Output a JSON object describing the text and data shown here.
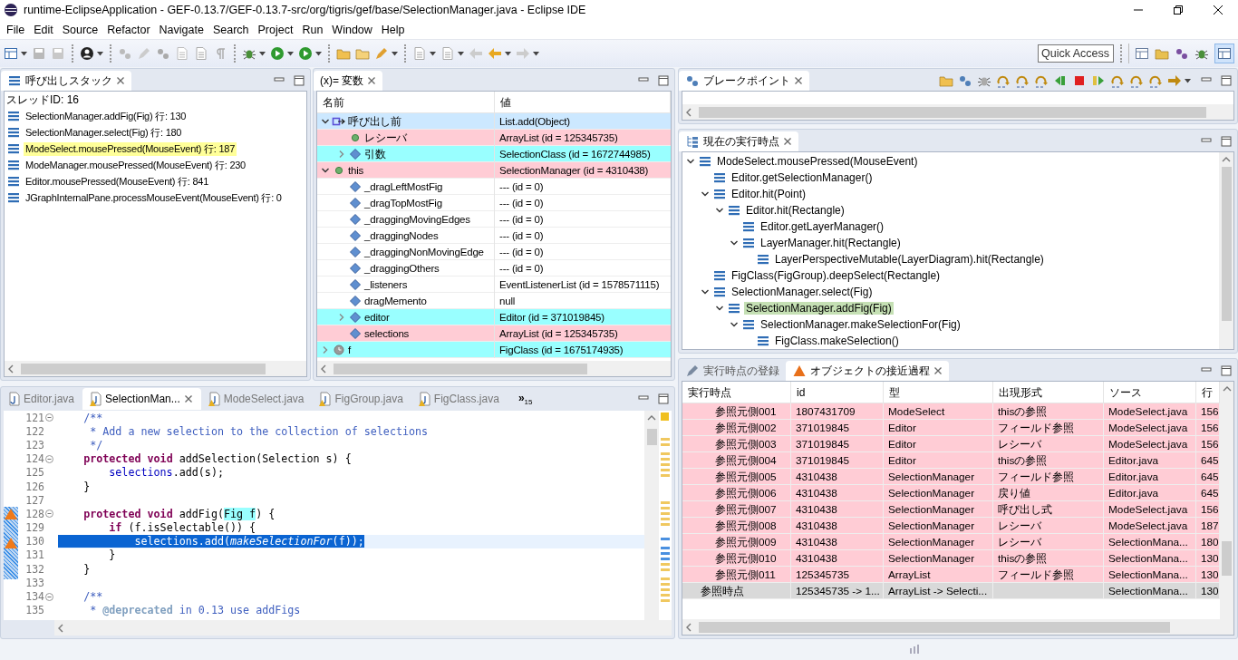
{
  "window": {
    "title": "runtime-EclipseApplication - GEF-0.13.7/GEF-0.13.7-src/org/tigris/gef/base/SelectionManager.java - Eclipse IDE"
  },
  "menu": [
    "File",
    "Edit",
    "Source",
    "Refactor",
    "Navigate",
    "Search",
    "Project",
    "Run",
    "Window",
    "Help"
  ],
  "toolbar": {
    "quick_access": {
      "placeholder": "Quick Access"
    }
  },
  "call_stack": {
    "tabs": [
      {
        "label": "呼び出しスタック",
        "selected": true
      }
    ],
    "thread": "スレッドID: 16",
    "frames": [
      {
        "label": "SelectionManager.addFig(Fig) 行: 130",
        "selected": false
      },
      {
        "label": "SelectionManager.select(Fig) 行: 180",
        "selected": false
      },
      {
        "label": "ModeSelect.mousePressed(MouseEvent) 行: 187",
        "selected": true
      },
      {
        "label": "ModeManager.mousePressed(MouseEvent) 行: 230",
        "selected": false
      },
      {
        "label": "Editor.mousePressed(MouseEvent) 行: 841",
        "selected": false
      },
      {
        "label": "JGraphInternalPane.processMouseEvent(MouseEvent) 行: 0",
        "selected": false
      }
    ]
  },
  "variables": {
    "tabs": [
      {
        "label": "(x)= 変数",
        "selected": true
      }
    ],
    "columns": [
      "名前",
      "値"
    ],
    "rows": [
      {
        "name": "呼び出し前",
        "value": "List.add(Object)",
        "kind": "call",
        "expanded": true,
        "color": "#cce8ff",
        "children": [
          {
            "name": "レシーバ",
            "value": "ArrayList (id = 125345735)",
            "kind": "local",
            "color": "#ffccd5"
          },
          {
            "name": "引数",
            "value": "SelectionClass (id = 1672744985)",
            "kind": "field",
            "expanded": false,
            "color": "#99ffff"
          }
        ]
      },
      {
        "name": "this",
        "value": "SelectionManager (id = 4310438)",
        "kind": "local",
        "expanded": true,
        "color": "#ffccd5",
        "children": [
          {
            "name": "_dragLeftMostFig",
            "value": "--- (id = 0)",
            "kind": "field"
          },
          {
            "name": "_dragTopMostFig",
            "value": "--- (id = 0)",
            "kind": "field"
          },
          {
            "name": "_draggingMovingEdges",
            "value": "--- (id = 0)",
            "kind": "field"
          },
          {
            "name": "_draggingNodes",
            "value": "--- (id = 0)",
            "kind": "field"
          },
          {
            "name": "_draggingNonMovingEdge",
            "value": "--- (id = 0)",
            "kind": "field"
          },
          {
            "name": "_draggingOthers",
            "value": "--- (id = 0)",
            "kind": "field"
          },
          {
            "name": "_listeners",
            "value": "EventListenerList (id = 1578571115)",
            "kind": "field"
          },
          {
            "name": "dragMemento",
            "value": "null",
            "kind": "field"
          },
          {
            "name": "editor",
            "value": "Editor (id = 371019845)",
            "kind": "field",
            "expanded": false,
            "color": "#99ffff"
          },
          {
            "name": "selections",
            "value": "ArrayList (id = 125345735)",
            "kind": "field",
            "color": "#ffccd5"
          }
        ]
      },
      {
        "name": "f",
        "value": "FigClass (id = 1675174935)",
        "kind": "lock",
        "expanded": false,
        "color": "#99ffff"
      }
    ]
  },
  "editor": {
    "tabs": [
      {
        "label": "Editor.java",
        "selected": false,
        "warning": false
      },
      {
        "label": "SelectionMan...",
        "selected": true,
        "warning": true
      },
      {
        "label": "ModeSelect.java",
        "selected": false,
        "warning": true
      },
      {
        "label": "FigGroup.java",
        "selected": false,
        "warning": true
      },
      {
        "label": "FigClass.java",
        "selected": false,
        "warning": true
      }
    ],
    "overflow": "»",
    "overflow_count": "15",
    "lines": [
      {
        "number": "121",
        "foldable": true,
        "code": [
          {
            "text": "    /**",
            "kind": "comment"
          }
        ]
      },
      {
        "number": "122",
        "code": [
          {
            "text": "     * Add a new selection to the collection of selections",
            "kind": "comment"
          }
        ]
      },
      {
        "number": "123",
        "code": [
          {
            "text": "     */",
            "kind": "comment"
          }
        ]
      },
      {
        "number": "124",
        "foldable": true,
        "code": [
          {
            "text": "    protected",
            "kind": "keyword"
          },
          {
            "text": " void",
            "kind": "keyword"
          },
          {
            "text": " addSelection(Selection s) {",
            "kind": "plain"
          }
        ]
      },
      {
        "number": "125",
        "code": [
          {
            "text": "        selections",
            "kind": "field"
          },
          {
            "text": ".add(s);",
            "kind": "plain"
          }
        ]
      },
      {
        "number": "126",
        "code": [
          {
            "text": "    }",
            "kind": "plain"
          }
        ]
      },
      {
        "number": "127"
      },
      {
        "number": "128",
        "foldable": true,
        "marker": true,
        "range": true,
        "code": [
          {
            "text": "    protected",
            "kind": "keyword"
          },
          {
            "text": " void",
            "kind": "keyword"
          },
          {
            "text": " addFig(",
            "kind": "plain"
          },
          {
            "text": "Fig f",
            "kind": "occurrence"
          },
          {
            "text": ") {",
            "kind": "plain"
          }
        ]
      },
      {
        "number": "129",
        "range": true,
        "code": [
          {
            "text": "        if",
            "kind": "keyword"
          },
          {
            "text": " (f.isSelectable()) {",
            "kind": "plain"
          }
        ]
      },
      {
        "number": "130",
        "marker": true,
        "range": true,
        "current": true,
        "code": [
          {
            "text": "            selections.add(",
            "kind": "plain"
          },
          {
            "text": "makeSelectionFor",
            "kind": "italic"
          },
          {
            "text": "(f));",
            "kind": "plain"
          }
        ]
      },
      {
        "number": "131",
        "range": true,
        "code": [
          {
            "text": "        }",
            "kind": "plain"
          }
        ]
      },
      {
        "number": "132",
        "range": true,
        "code": [
          {
            "text": "    }",
            "kind": "plain"
          }
        ]
      },
      {
        "number": "133"
      },
      {
        "number": "134",
        "foldable": true,
        "code": [
          {
            "text": "    /**",
            "kind": "comment"
          }
        ]
      },
      {
        "number": "135",
        "code": [
          {
            "text": "     * ",
            "kind": "comment"
          },
          {
            "text": "@deprecated",
            "kind": "tag"
          },
          {
            "text": " in 0.13 use addFigs",
            "kind": "comment"
          }
        ]
      }
    ]
  },
  "breakpoints": {
    "tabs": [
      {
        "label": "ブレークポイント",
        "selected": true
      }
    ]
  },
  "current_point": {
    "tabs": [
      {
        "label": "現在の実行時点",
        "selected": true
      }
    ],
    "nodes": [
      {
        "label": "ModeSelect.mousePressed(MouseEvent)",
        "selected": false,
        "expanded": true,
        "children": [
          {
            "label": "Editor.getSelectionManager()",
            "selected": false
          },
          {
            "label": "Editor.hit(Point)",
            "selected": false,
            "expanded": true,
            "children": [
              {
                "label": "Editor.hit(Rectangle)",
                "selected": false,
                "expanded": true,
                "children": [
                  {
                    "label": "Editor.getLayerManager()",
                    "selected": false
                  },
                  {
                    "label": "LayerManager.hit(Rectangle)",
                    "selected": false,
                    "expanded": true,
                    "children": [
                      {
                        "label": "LayerPerspectiveMutable(LayerDiagram).hit(Rectangle)",
                        "selected": false
                      }
                    ]
                  }
                ]
              }
            ]
          },
          {
            "label": "FigClass(FigGroup).deepSelect(Rectangle)",
            "selected": false
          },
          {
            "label": "SelectionManager.select(Fig)",
            "selected": false,
            "expanded": true,
            "children": [
              {
                "label": "SelectionManager.addFig(Fig)",
                "selected": true,
                "expanded": true,
                "children": [
                  {
                    "label": "SelectionManager.makeSelectionFor(Fig)",
                    "selected": false,
                    "expanded": true,
                    "children": [
                      {
                        "label": "FigClass.makeSelection()",
                        "selected": false
                      }
                    ]
                  }
                ]
              }
            ]
          }
        ]
      }
    ]
  },
  "object_history": {
    "tabs": [
      {
        "label": "実行時点の登録",
        "selected": false
      },
      {
        "label": "オブジェクトの接近過程",
        "selected": true
      }
    ],
    "columns": [
      "実行時点",
      "id",
      "型",
      "出現形式",
      "ソース",
      "行"
    ],
    "rows": [
      {
        "kind": "reference",
        "cells": [
          "参照元側001",
          "1807431709",
          "ModeSelect",
          "thisの参照",
          "ModeSelect.java",
          "156"
        ]
      },
      {
        "kind": "reference",
        "cells": [
          "参照元側002",
          "371019845",
          "Editor",
          "フィールド参照",
          "ModeSelect.java",
          "156"
        ]
      },
      {
        "kind": "reference",
        "cells": [
          "参照元側003",
          "371019845",
          "Editor",
          "レシーバ",
          "ModeSelect.java",
          "156"
        ]
      },
      {
        "kind": "reference",
        "cells": [
          "参照元側004",
          "371019845",
          "Editor",
          "thisの参照",
          "Editor.java",
          "645"
        ]
      },
      {
        "kind": "reference",
        "cells": [
          "参照元側005",
          "4310438",
          "SelectionManager",
          "フィールド参照",
          "Editor.java",
          "645"
        ]
      },
      {
        "kind": "reference",
        "cells": [
          "参照元側006",
          "4310438",
          "SelectionManager",
          "戻り値",
          "Editor.java",
          "645"
        ]
      },
      {
        "kind": "reference",
        "cells": [
          "参照元側007",
          "4310438",
          "SelectionManager",
          "呼び出し式",
          "ModeSelect.java",
          "156"
        ]
      },
      {
        "kind": "reference",
        "cells": [
          "参照元側008",
          "4310438",
          "SelectionManager",
          "レシーバ",
          "ModeSelect.java",
          "187"
        ]
      },
      {
        "kind": "reference",
        "cells": [
          "参照元側009",
          "4310438",
          "SelectionManager",
          "レシーバ",
          "SelectionMana...",
          "180"
        ]
      },
      {
        "kind": "reference",
        "cells": [
          "参照元側010",
          "4310438",
          "SelectionManager",
          "thisの参照",
          "SelectionMana...",
          "130"
        ]
      },
      {
        "kind": "reference",
        "cells": [
          "参照元側011",
          "125345735",
          "ArrayList",
          "フィールド参照",
          "SelectionMana...",
          "130"
        ]
      },
      {
        "kind": "point",
        "cells": [
          "参照時点",
          "125345735 -> 1...",
          "ArrayList -> Selecti...",
          null,
          "SelectionMana...",
          "130"
        ]
      }
    ]
  }
}
